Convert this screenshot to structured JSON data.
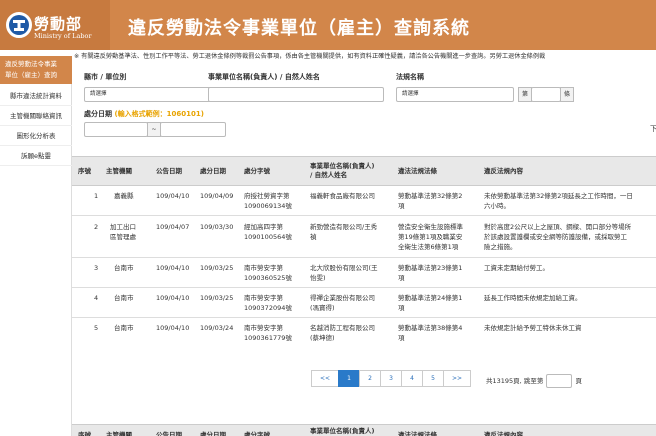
{
  "header": {
    "logo_cn": "勞動部",
    "logo_en": "Ministry of Labor",
    "title": "違反勞動法令事業單位（雇主）查詢系統"
  },
  "notice": "※ 有關違反勞動基準法、性別工作平等法、勞工退休金條例等裁罰公告事項，係由各主管機關提供，如有資料正確性疑義，請洽各公告機關進一步查詢。另勞工退休金條例裁",
  "sidebar": {
    "active_line1": "違反勞動法令事業",
    "active_line2": "單位（雇主）查詢",
    "items": [
      "縣市違法統計資料",
      "主管機關聯絡資訊",
      "圖形化分析表",
      "訴願e點靈"
    ]
  },
  "form": {
    "county_label": "縣市 / 單位別",
    "county_value": "請選擇",
    "unit_label": "事業單位名稱(負責人) / 自然人姓名",
    "law_label": "法規名稱",
    "law_value": "請選擇",
    "page_prefix": "第",
    "page_suffix": "條",
    "date_label": "處分日期",
    "date_hint": "(輸入格式範例：1060101)",
    "date_sep": "~",
    "edge_char": "下"
  },
  "table": {
    "headers": {
      "no": "序號",
      "agency": "主管機關",
      "announce_date": "公告日期",
      "penalty_date": "處分日期",
      "doc_no": "處分字號",
      "unit_l1": "事業單位名稱(負責人)",
      "unit_l2": "/ 自然人姓名",
      "law": "違法法規法條",
      "content": "違反法規內容"
    },
    "rows": [
      {
        "no": "1",
        "agency_l1": "嘉義縣",
        "agency_l2": "",
        "announce": "109/04/10",
        "penalty": "109/04/09",
        "doc_l1": "府授社勞資字第",
        "doc_l2": "1090069134號",
        "unit_l1": "福義軒食品廠有限公司",
        "unit_l2": "",
        "law_l1": "勞動基準法第32條第2",
        "law_l2": "項",
        "content_l1": "未依勞動基準法第32條第2項延長之工作時間，一日",
        "content_l2": "六小時。",
        "content_l3": ""
      },
      {
        "no": "2",
        "agency_l1": "加工出口",
        "agency_l2": "區管理處",
        "announce": "109/04/07",
        "penalty": "109/03/30",
        "doc_l1": "經加高四字第",
        "doc_l2": "1090100564號",
        "unit_l1": "新勁營造有限公司/王秀",
        "unit_l2": "禎",
        "law_l1": "營造安全衛生設施標準",
        "law_l2": "第19條第1項及職業安",
        "law_l3": "全衛生法第6條第1項",
        "content_l1": "對於高度2公尺以上之屋頂、鋼樑、開口部分等場所",
        "content_l2": "於該處設置護欄或安全網等防護設備，或採取勞工",
        "content_l3": "險之措施。"
      },
      {
        "no": "3",
        "agency_l1": "台南市",
        "agency_l2": "",
        "announce": "109/04/10",
        "penalty": "109/03/25",
        "doc_l1": "南市勞安字第",
        "doc_l2": "1090360525號",
        "unit_l1": "北大欣股份有限公司(王",
        "unit_l2": "怡雯)",
        "law_l1": "勞動基準法第23條第1",
        "law_l2": "項",
        "content_l1": "工資未定期給付勞工。",
        "content_l2": "",
        "content_l3": ""
      },
      {
        "no": "4",
        "agency_l1": "台南市",
        "agency_l2": "",
        "announce": "109/04/10",
        "penalty": "109/03/25",
        "doc_l1": "南市勞安字第",
        "doc_l2": "1090372094號",
        "unit_l1": "得禪企業股份有限公司",
        "unit_l2": "(馮寶得)",
        "law_l1": "勞動基準法第24條第1",
        "law_l2": "項",
        "content_l1": "延長工作時間未依規定加給工資。",
        "content_l2": "",
        "content_l3": ""
      },
      {
        "no": "5",
        "agency_l1": "台南市",
        "agency_l2": "",
        "announce": "109/04/10",
        "penalty": "109/03/24",
        "doc_l1": "南市勞安字第",
        "doc_l2": "1090361779號",
        "unit_l1": "名越消防工程有限公司",
        "unit_l2": "(蔡坤德)",
        "law_l1": "勞動基準法第38條第4",
        "law_l2": "項",
        "content_l1": "未依規定計給予勞工特休未休工資",
        "content_l2": "",
        "content_l3": ""
      }
    ]
  },
  "pagination": {
    "prev": "<<",
    "pages": [
      "1",
      "2",
      "3",
      "4",
      "5"
    ],
    "next": ">>",
    "total": "共13195頁,",
    "jump_prefix": "跳至第",
    "jump_suffix": "頁"
  },
  "colors": {
    "brand": "#d2864a",
    "active_page": "#2a7ac9",
    "hint": "#e8a300"
  }
}
